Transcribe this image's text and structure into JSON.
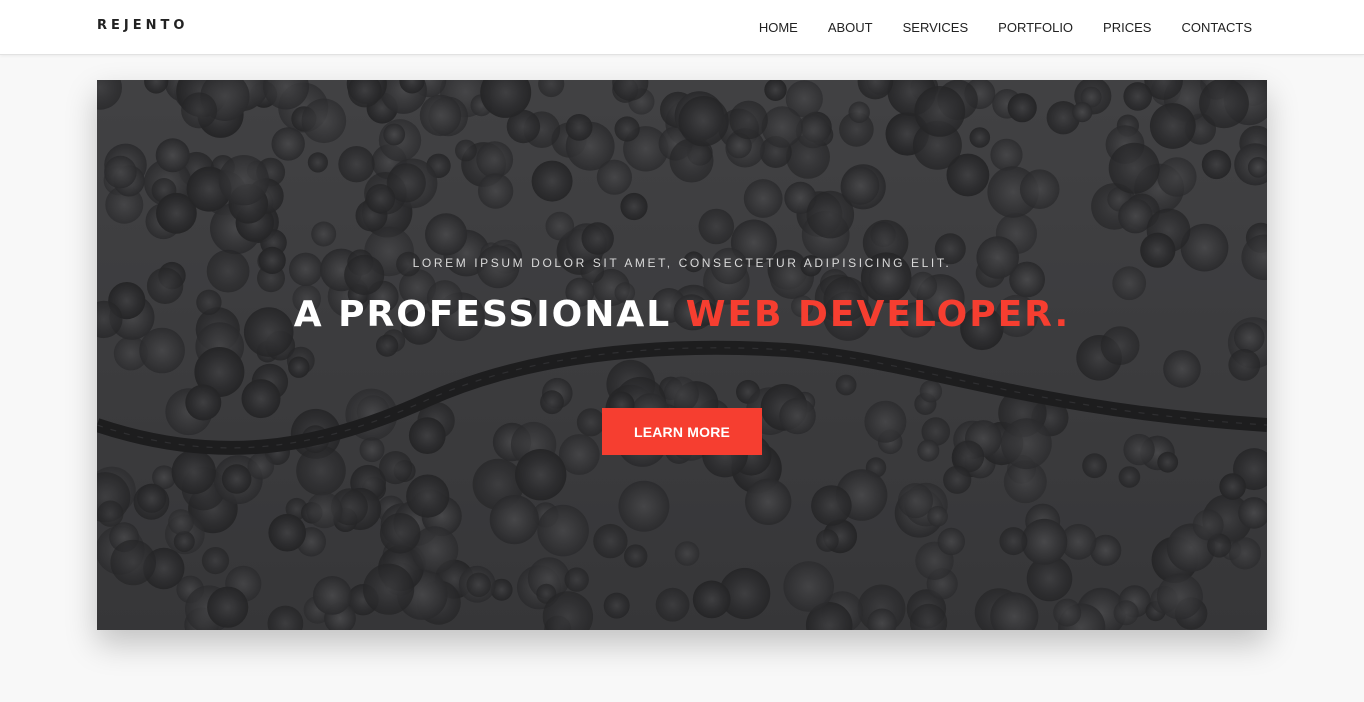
{
  "header": {
    "brand": "REJENTO",
    "nav_items": [
      {
        "label": "HOME"
      },
      {
        "label": "ABOUT"
      },
      {
        "label": "SERVICES"
      },
      {
        "label": "PORTFOLIO"
      },
      {
        "label": "PRICES"
      },
      {
        "label": "CONTACTS"
      }
    ]
  },
  "hero": {
    "tagline": "LOREM IPSUM DOLOR SIT AMET, CONSECTETUR ADIPISICING ELIT.",
    "headline_main": "A PROFESSIONAL",
    "headline_accent": "WEB DEVELOPER.",
    "button_label": "LEARN MORE"
  },
  "colors": {
    "accent": "#f63e30",
    "page_background": "#f8f8f8",
    "header_background": "#ffffff",
    "hero_overlay": "#2b2b2d"
  }
}
